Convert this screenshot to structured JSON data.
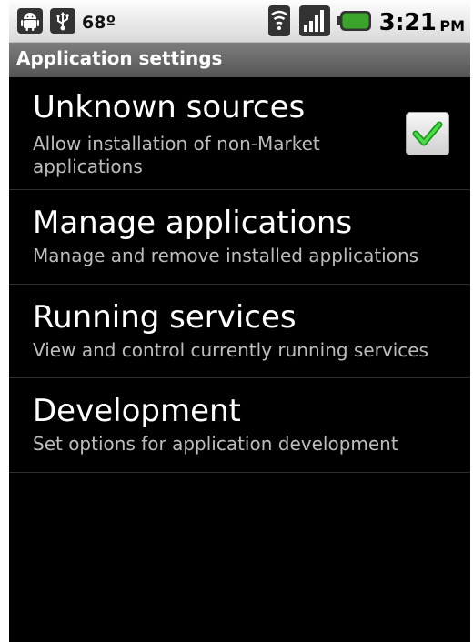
{
  "status_bar": {
    "left_icons": [
      "android-debug-icon",
      "usb-icon"
    ],
    "temperature": "68º",
    "right_icons": [
      "wifi-icon",
      "signal-icon",
      "battery-icon"
    ],
    "time": "3:21",
    "ampm": "PM"
  },
  "title_bar": {
    "title": "Application settings"
  },
  "settings": [
    {
      "title": "Unknown sources",
      "summary": "Allow installation of non-Market applications",
      "checked": true
    },
    {
      "title": "Manage applications",
      "summary": "Manage and remove installed applications"
    },
    {
      "title": "Running services",
      "summary": "View and control currently running services"
    },
    {
      "title": "Development",
      "summary": "Set options for application development"
    }
  ],
  "colors": {
    "check": "#2fbf2f",
    "battery": "#3aa52a"
  }
}
